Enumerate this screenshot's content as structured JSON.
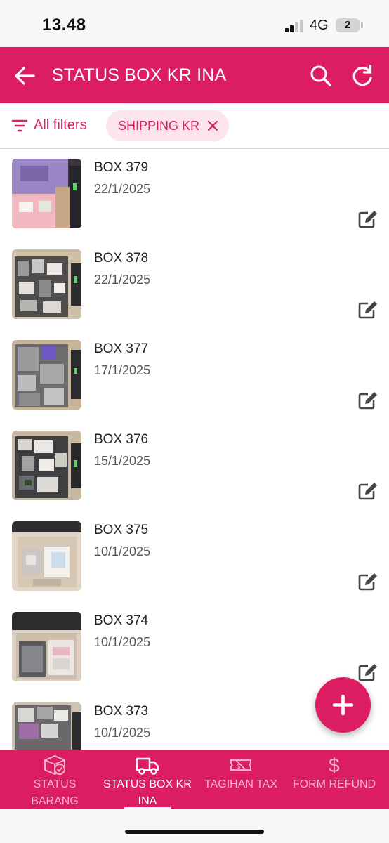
{
  "status_bar": {
    "time": "13.48",
    "network": "4G",
    "battery": "2"
  },
  "app_bar": {
    "title": "STATUS BOX KR INA",
    "back_icon": "arrow-left-icon",
    "search_icon": "search-icon",
    "refresh_icon": "refresh-icon"
  },
  "filters": {
    "all_filters_label": "All filters",
    "active_chip": "SHIPPING KR"
  },
  "boxes": [
    {
      "title": "BOX 379",
      "date": "22/1/2025"
    },
    {
      "title": "BOX 378",
      "date": "22/1/2025"
    },
    {
      "title": "BOX 377",
      "date": "17/1/2025"
    },
    {
      "title": "BOX 376",
      "date": "15/1/2025"
    },
    {
      "title": "BOX 375",
      "date": "10/1/2025"
    },
    {
      "title": "BOX 374",
      "date": "10/1/2025"
    },
    {
      "title": "BOX 373",
      "date": "10/1/2025"
    }
  ],
  "bottom_nav": [
    {
      "label": "STATUS BARANG",
      "icon": "package-check-icon",
      "active": false
    },
    {
      "label": "STATUS BOX KR INA",
      "icon": "truck-icon",
      "active": true
    },
    {
      "label": "TAGIHAN TAX",
      "icon": "ticket-icon",
      "active": false
    },
    {
      "label": "FORM REFUND",
      "icon": "dollar-icon",
      "active": false
    }
  ],
  "colors": {
    "primary": "#dc1d62",
    "chip_bg": "#fbe4ec",
    "inactive_nav": "#f6b6cb"
  }
}
